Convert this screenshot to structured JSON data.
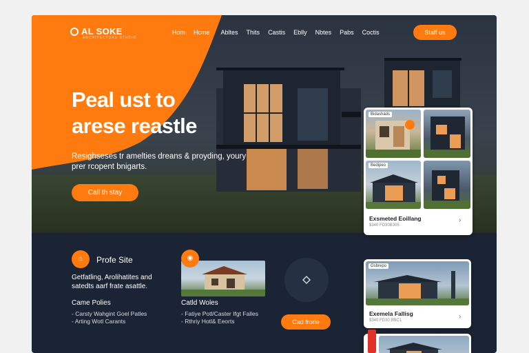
{
  "brand": {
    "name": "AL SOKE",
    "tagline": "ARCHITECTURE STUDIO"
  },
  "nav": {
    "items": [
      "Hom",
      "Hcme",
      "Abltes",
      "Thits",
      "Castis",
      "Eblly",
      "Nbtes",
      "Pabs",
      "Coctis"
    ]
  },
  "header": {
    "cta_label": "Staff us"
  },
  "hero": {
    "title_line1": "Peal ust to",
    "title_line2": "arese reastle",
    "subtitle": "Resighseses tr amelties dreans & proyding, youry prer rcopent bnigarts.",
    "button_label": "Call th stay"
  },
  "gallery_card": {
    "thumb1_label": "Bidashads",
    "thumb3_label": "Bedipeo",
    "title": "Exsmeted Eoillang",
    "meta": "$340 FD30B305"
  },
  "features": [
    {
      "icon": "home-icon",
      "title": "Profe Site",
      "desc": "Getfatling, Arolihatites and satedts aarf frate asattle.",
      "subtitle": "Came Polies",
      "list": [
        "Carsty Wahgint Goel Patles",
        "Arting Wotl Carants"
      ]
    },
    {
      "icon": "location-pin-icon",
      "subtitle": "Catld Woles",
      "list": [
        "Fatiye Potl/Caster Ifgt Falles",
        "Rthriy Hotl& Eeorts"
      ],
      "button_label": "Cad frorie"
    }
  ],
  "listing_card": {
    "thumb_label": "Gsbrepo",
    "title": "Exemela Fallisg",
    "meta": "$340 FD30 BBC1"
  },
  "colors": {
    "accent": "#ff7a0f",
    "dark": "#1b2434"
  }
}
